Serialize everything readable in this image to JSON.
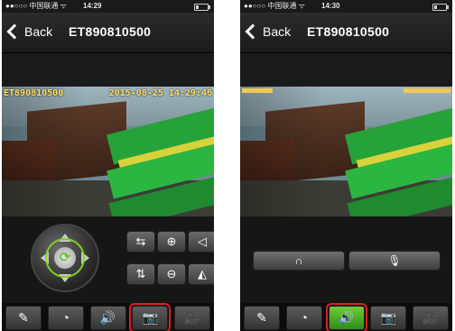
{
  "screens": [
    {
      "status": {
        "carrier": "●●○○○ 中国联通 ᯤ",
        "time": "14:29"
      },
      "nav": {
        "back_label": "Back",
        "title": "ET890810500"
      },
      "osd": {
        "camera_id": "ET890810500",
        "timestamp": "2015-08-25 14:29:46"
      },
      "ptz": {
        "buttons": [
          {
            "id": "swap-h",
            "icon": "horizontal-flip-arrows-icon",
            "glyph": "⇆"
          },
          {
            "id": "zoom-in",
            "icon": "zoom-in-icon",
            "glyph": "⊕"
          },
          {
            "id": "sound",
            "icon": "megaphone-icon",
            "glyph": "◁"
          },
          {
            "id": "swap-v",
            "icon": "vertical-flip-arrows-icon",
            "glyph": "⇅"
          },
          {
            "id": "zoom-out",
            "icon": "zoom-out-icon",
            "glyph": "⊖"
          },
          {
            "id": "mirror",
            "icon": "mirror-icon",
            "glyph": "◭"
          }
        ]
      },
      "tabs": [
        {
          "icon": "settings-tools-icon",
          "glyph": "✎"
        },
        {
          "icon": "dashboard-gauge-icon",
          "glyph": "◔"
        },
        {
          "icon": "speaker-icon",
          "glyph": "🔊"
        },
        {
          "icon": "camera-icon",
          "glyph": "📷"
        },
        {
          "icon": "video-camera-icon",
          "glyph": "🎥"
        }
      ],
      "selected_tab": 3
    },
    {
      "status": {
        "carrier": "●●○○○ 中国联通 ᯤ",
        "time": "14:30"
      },
      "nav": {
        "back_label": "Back",
        "title": "ET890810500"
      },
      "talk": {
        "listen_icon": "headphones-icon",
        "speak_icon": "microphone-icon"
      },
      "tabs": [
        {
          "icon": "settings-tools-icon",
          "glyph": "✎"
        },
        {
          "icon": "dashboard-gauge-icon",
          "glyph": "◔"
        },
        {
          "icon": "speaker-icon",
          "glyph": "🔊"
        },
        {
          "icon": "camera-icon",
          "glyph": "📷"
        },
        {
          "icon": "video-camera-icon",
          "glyph": "🎥"
        }
      ],
      "selected_tab": 2
    }
  ],
  "colors": {
    "accent_green": "#6ac13b",
    "selection_red": "#e01e1e"
  }
}
